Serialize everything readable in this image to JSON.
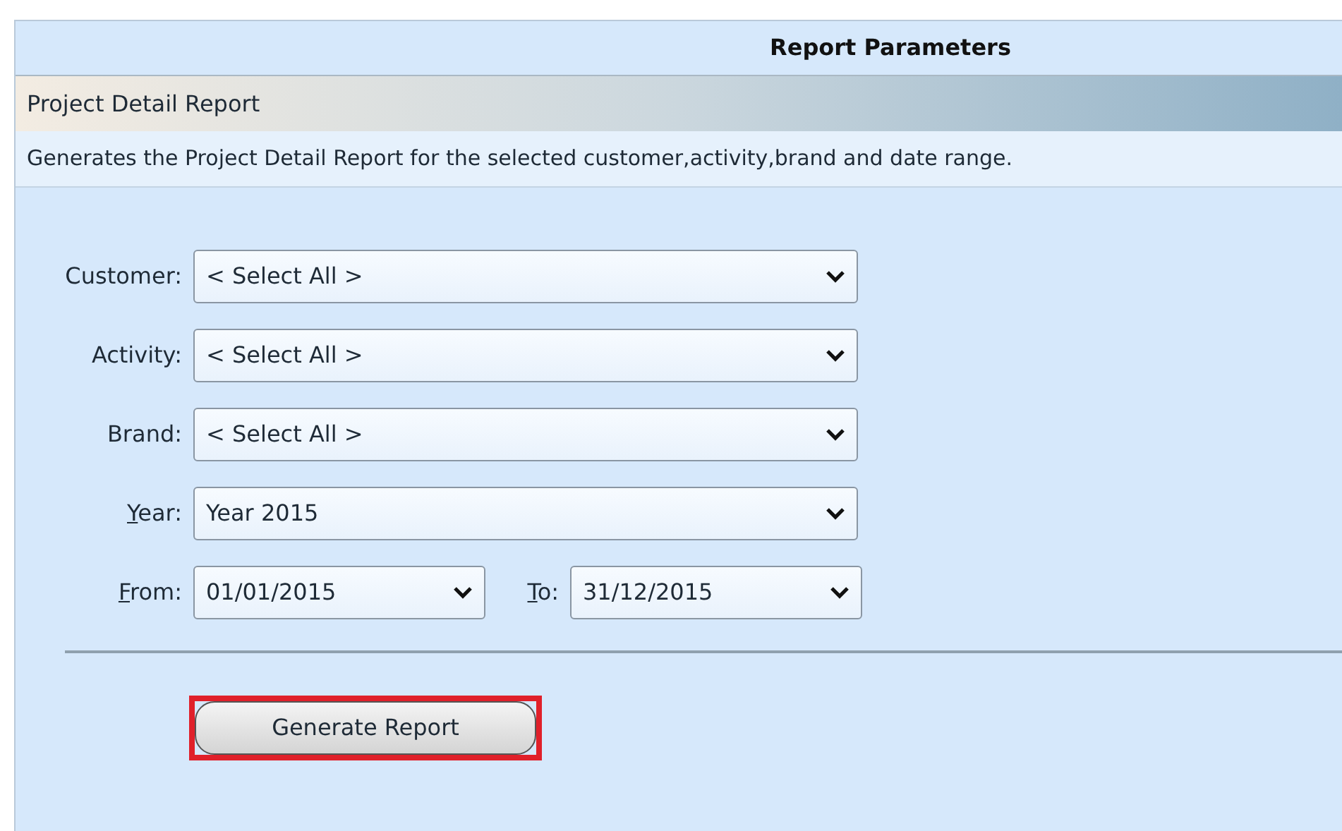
{
  "panel_title": "Report Parameters",
  "report": {
    "name": "Project Detail Report",
    "description": "Generates the Project Detail Report for the selected customer,activity,brand and date range."
  },
  "fields": [
    {
      "label": "Customer:",
      "value": "< Select All >",
      "mnemonic": false
    },
    {
      "label": "Activity:",
      "value": "< Select All >",
      "mnemonic": false
    },
    {
      "label": "Brand:",
      "value": "< Select All >",
      "mnemonic": false
    },
    {
      "label": "Year:",
      "value": "Year 2015",
      "mnemonic": true
    }
  ],
  "date_range": {
    "from": {
      "label": "From:",
      "value": "01/01/2015",
      "mnemonic": true
    },
    "to": {
      "label": "To:",
      "value": "31/12/2015",
      "mnemonic": true
    }
  },
  "generate_button": {
    "label": "Generate Report",
    "highlighted": true
  }
}
